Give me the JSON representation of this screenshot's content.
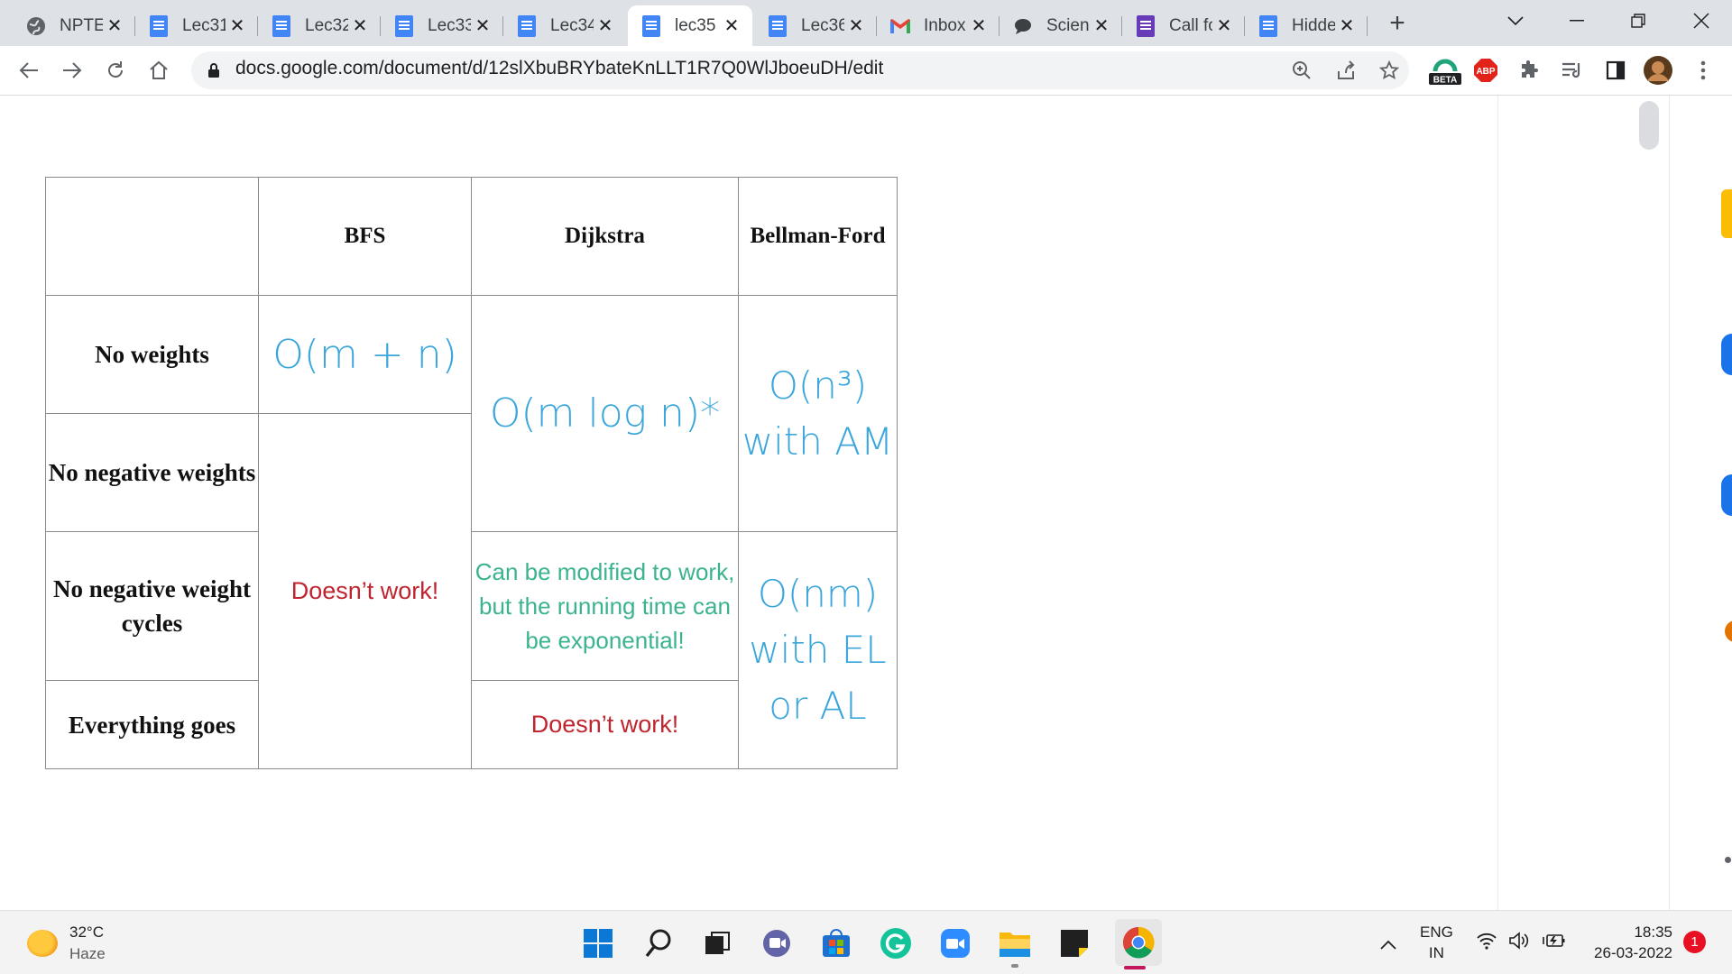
{
  "tabs": [
    {
      "title": "NPTEL",
      "icon": "globe-icon"
    },
    {
      "title": "Lec31",
      "icon": "docs-icon"
    },
    {
      "title": "Lec32",
      "icon": "docs-icon"
    },
    {
      "title": "Lec33",
      "icon": "docs-icon"
    },
    {
      "title": "Lec34",
      "icon": "docs-icon"
    },
    {
      "title": "lec35",
      "icon": "docs-icon",
      "active": true
    },
    {
      "title": "Lec36",
      "icon": "docs-icon"
    },
    {
      "title": "Inbox",
      "icon": "gmail-icon"
    },
    {
      "title": "Science",
      "icon": "chat-icon"
    },
    {
      "title": "Call for",
      "icon": "forms-icon"
    },
    {
      "title": "Hidden",
      "icon": "docs-icon"
    }
  ],
  "address": {
    "url": "docs.google.com/document/d/12slXbuBRYbateKnLLT1R7Q0WlJboeuDH/edit"
  },
  "extensions": {
    "beta_label": "BETA",
    "abp_label": "ABP"
  },
  "table": {
    "headers": [
      "BFS",
      "Dijkstra",
      "Bellman-Ford"
    ],
    "rows": [
      "No weights",
      "No negative weights",
      "No negative weight cycles",
      "Everything goes"
    ],
    "bfs_no_weights": "O(m + n)",
    "bfs_other": "Doesn’t work!",
    "dijkstra_main": "O(m log n)*",
    "dijkstra_neg_cycles": "Can be modified to work, but the running time can be exponential!",
    "dijkstra_everything": "Doesn’t work!",
    "bellman_top_1": "O(n³)",
    "bellman_top_2": "with AM",
    "bellman_bottom_1": "O(nm)",
    "bellman_bottom_2": "with EL",
    "bellman_bottom_3": "or AL"
  },
  "taskbar": {
    "weather_temp": "32°C",
    "weather_desc": "Haze",
    "lang_top": "ENG",
    "lang_bottom": "IN",
    "time": "18:35",
    "date": "26-03-2022",
    "notification_count": "1"
  },
  "colors": {
    "blue": "#3aa6dc",
    "red": "#c0242f",
    "green": "#3bb38f"
  }
}
